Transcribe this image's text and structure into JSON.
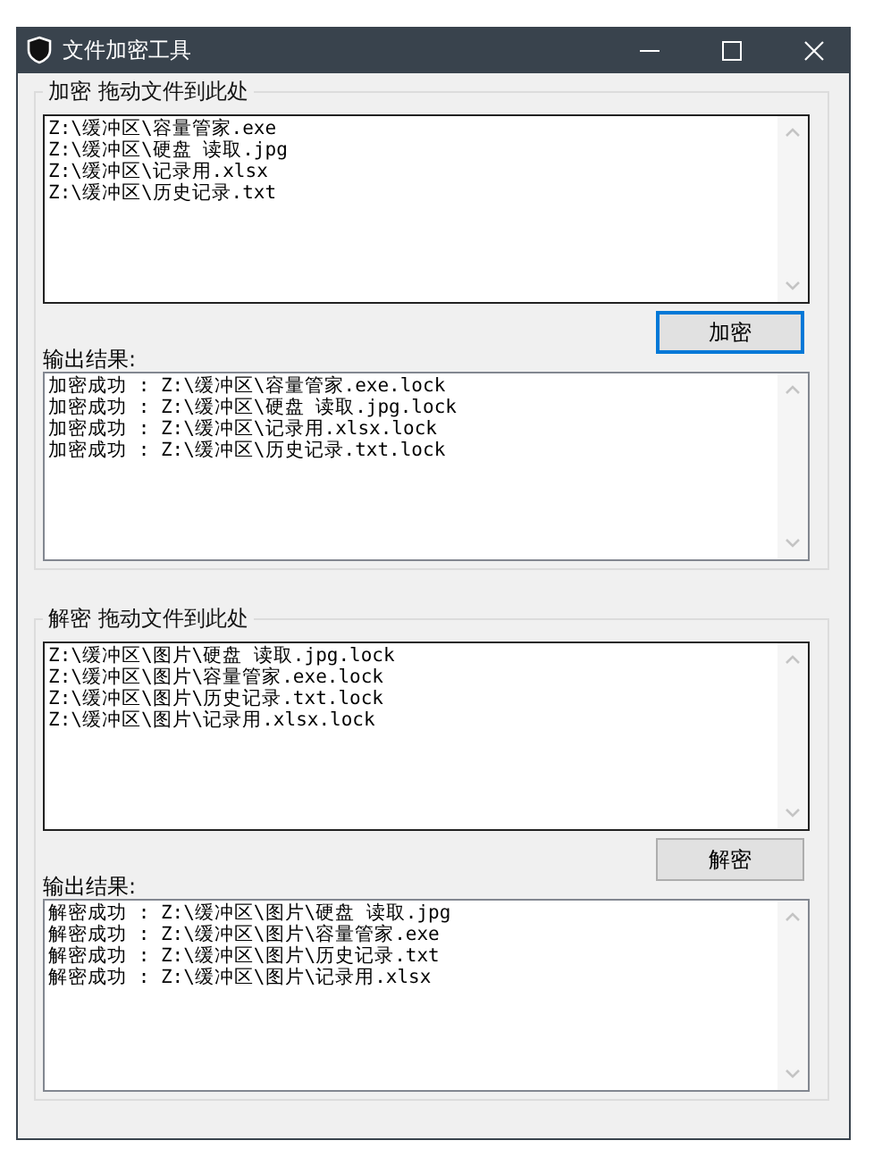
{
  "window": {
    "title": "文件加密工具"
  },
  "groups": [
    {
      "legend": "加密 拖动文件到此处",
      "files": [
        "Z:\\缓冲区\\容量管家.exe",
        "Z:\\缓冲区\\硬盘 读取.jpg",
        "Z:\\缓冲区\\记录用.xlsx",
        "Z:\\缓冲区\\历史记录.txt"
      ],
      "button": {
        "label": "加密",
        "focused": true
      },
      "output_label": "输出结果:",
      "output": [
        "加密成功 : Z:\\缓冲区\\容量管家.exe.lock",
        "加密成功 : Z:\\缓冲区\\硬盘 读取.jpg.lock",
        "加密成功 : Z:\\缓冲区\\记录用.xlsx.lock",
        "加密成功 : Z:\\缓冲区\\历史记录.txt.lock"
      ]
    },
    {
      "legend": "解密 拖动文件到此处",
      "files": [
        "Z:\\缓冲区\\图片\\硬盘 读取.jpg.lock",
        "Z:\\缓冲区\\图片\\容量管家.exe.lock",
        "Z:\\缓冲区\\图片\\历史记录.txt.lock",
        "Z:\\缓冲区\\图片\\记录用.xlsx.lock"
      ],
      "button": {
        "label": "解密",
        "focused": false
      },
      "output_label": "输出结果:",
      "output": [
        "解密成功 : Z:\\缓冲区\\图片\\硬盘 读取.jpg",
        "解密成功 : Z:\\缓冲区\\图片\\容量管家.exe",
        "解密成功 : Z:\\缓冲区\\图片\\历史记录.txt",
        "解密成功 : Z:\\缓冲区\\图片\\记录用.xlsx"
      ]
    }
  ]
}
